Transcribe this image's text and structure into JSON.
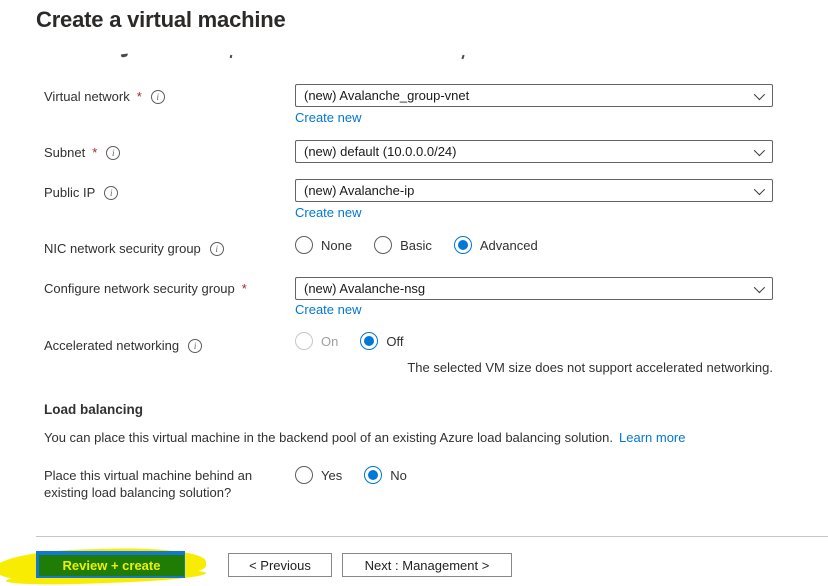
{
  "page": {
    "title": "Create a virtual machine"
  },
  "icons": {
    "info": "i"
  },
  "colors": {
    "link_blue": "#0078d4",
    "radio_selected": "#0078d4",
    "required_red": "#a4262c",
    "button_blue": "#1178d4",
    "highlight_yellow": "#f9ec03",
    "highlighted_button_green": "#1f7d05"
  },
  "form": {
    "required_marker": "*",
    "fields": [
      {
        "type": "dropdown",
        "label": "Virtual network",
        "required": true,
        "info": true,
        "value": "(new) Avalanche_group-vnet",
        "create_new": "Create new"
      },
      {
        "type": "dropdown",
        "label": "Subnet",
        "required": true,
        "info": true,
        "value": "(new) default (10.0.0.0/24)"
      },
      {
        "type": "dropdown",
        "label": "Public IP",
        "required": false,
        "info": true,
        "value": "(new) Avalanche-ip",
        "create_new": "Create new"
      },
      {
        "type": "radio",
        "label": "NIC network security group",
        "info": true,
        "options": [
          {
            "label": "None",
            "selected": false
          },
          {
            "label": "Basic",
            "selected": false
          },
          {
            "label": "Advanced",
            "selected": true
          }
        ],
        "selected": "Advanced"
      },
      {
        "type": "dropdown",
        "label": "Configure network security group",
        "required": true,
        "info": false,
        "value": "(new) Avalanche-nsg",
        "create_new": "Create new"
      },
      {
        "type": "radio",
        "label": "Accelerated networking",
        "info": true,
        "options": [
          {
            "label": "On",
            "selected": false,
            "disabled": true
          },
          {
            "label": "Off",
            "selected": true,
            "disabled": false
          }
        ],
        "selected": "Off",
        "note": "The selected VM size does not support accelerated networking."
      }
    ]
  },
  "load_balancing": {
    "heading": "Load balancing",
    "description": "You can place this virtual machine in the backend pool of an existing Azure load balancing solution.",
    "learn_more": "Learn more",
    "question": "Place this virtual machine behind an existing load balancing solution?",
    "options": [
      {
        "label": "Yes",
        "selected": false
      },
      {
        "label": "No",
        "selected": true
      }
    ],
    "selected": "No"
  },
  "footer": {
    "review_create": "Review + create",
    "previous": "< Previous",
    "next": "Next : Management >"
  }
}
